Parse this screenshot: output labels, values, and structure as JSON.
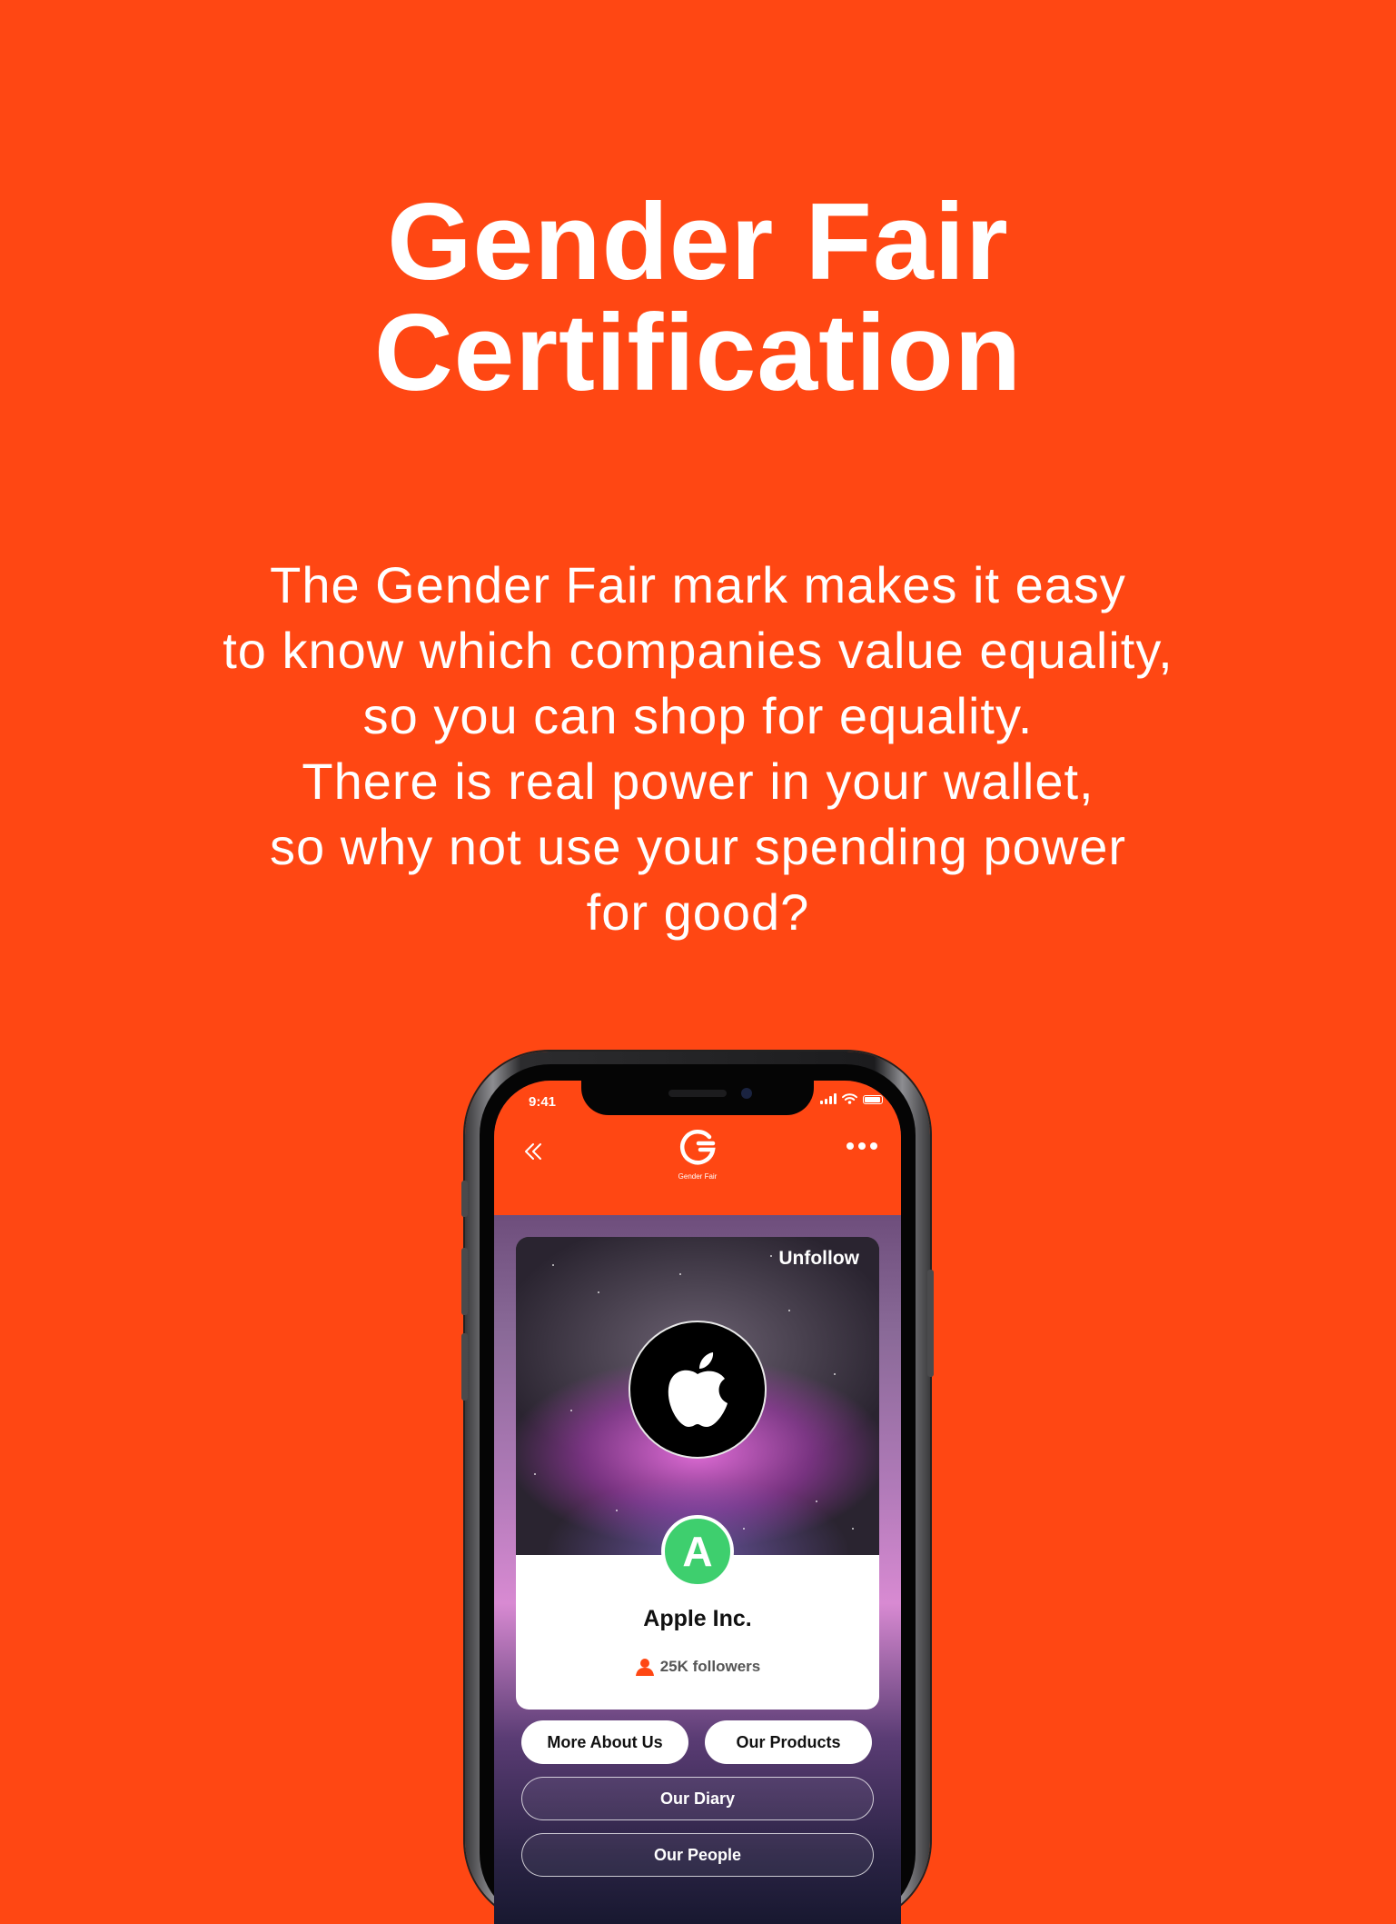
{
  "colors": {
    "background": "#ff4713",
    "text": "#ffffff",
    "grade": "#3ecf6e"
  },
  "headline": {
    "line1": "Gender Fair",
    "line2": "Certification"
  },
  "tagline": [
    "The Gender Fair mark makes it easy",
    "to know which companies value equality,",
    "so you can shop for equality.",
    "There is real power in your wallet,",
    "so why not use your spending power",
    "for good?"
  ],
  "phone": {
    "status_bar": {
      "time": "9:41",
      "icons": [
        "signal-icon",
        "wifi-icon",
        "battery-icon"
      ]
    },
    "app_bar": {
      "logo_text": "Gender Fair",
      "icons": [
        "back-chevron-icon",
        "gender-fair-logo-icon",
        "more-icon"
      ]
    },
    "company_card": {
      "action": "Unfollow",
      "logo_icon": "apple-logo-icon",
      "grade": "A",
      "name": "Apple Inc.",
      "followers": "25K followers",
      "followers_icon": "person-icon"
    },
    "buttons": {
      "more_about": "More About Us",
      "products": "Our Products",
      "diary": "Our Diary",
      "people": "Our People"
    }
  }
}
